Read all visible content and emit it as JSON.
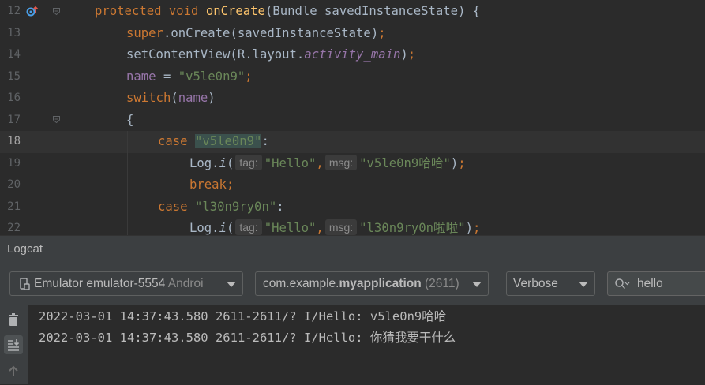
{
  "editor": {
    "lines": [
      {
        "num": "12",
        "parts": [
          {
            "t": "protected void ",
            "c": "kw"
          },
          {
            "t": "onCreate",
            "c": "fn"
          },
          {
            "t": "(Bundle savedInstanceState) {",
            "c": ""
          }
        ]
      },
      {
        "num": "13",
        "parts": [
          {
            "t": "super",
            "c": "kw"
          },
          {
            "t": ".onCreate(savedInstanceState)",
            "c": ""
          },
          {
            "t": ";",
            "c": "kw"
          }
        ]
      },
      {
        "num": "14",
        "parts": [
          {
            "t": "setContentView(R.layout.",
            "c": ""
          },
          {
            "t": "activity_main",
            "c": "ital"
          },
          {
            "t": ")",
            "c": ""
          },
          {
            "t": ";",
            "c": "kw"
          }
        ]
      },
      {
        "num": "15",
        "parts": [
          {
            "t": "name",
            "c": "fld"
          },
          {
            "t": " = ",
            "c": ""
          },
          {
            "t": "\"v5le0n9\"",
            "c": "str"
          },
          {
            "t": ";",
            "c": "kw"
          }
        ]
      },
      {
        "num": "16",
        "parts": [
          {
            "t": "switch",
            "c": "kw"
          },
          {
            "t": "(",
            "c": ""
          },
          {
            "t": "name",
            "c": "fld"
          },
          {
            "t": ")",
            "c": ""
          }
        ]
      },
      {
        "num": "17",
        "parts": [
          {
            "t": "{",
            "c": ""
          }
        ]
      },
      {
        "num": "18",
        "parts": [
          {
            "t": "case ",
            "c": "kw"
          },
          {
            "t": "\"v5le0n9\"",
            "c": "str hl"
          },
          {
            "t": ":",
            "c": ""
          }
        ]
      },
      {
        "num": "19",
        "parts": [
          {
            "t": "Log.",
            "c": ""
          },
          {
            "t": "i",
            "c": "mth"
          },
          {
            "t": "(",
            "c": ""
          },
          {
            "t": "tag:",
            "c": "hint"
          },
          {
            "t": "\"Hello\"",
            "c": "str"
          },
          {
            "t": ",",
            "c": "kw"
          },
          {
            "t": "msg:",
            "c": "hint"
          },
          {
            "t": "\"v5le0n9哈哈\"",
            "c": "str"
          },
          {
            "t": ")",
            "c": ""
          },
          {
            "t": ";",
            "c": "kw"
          }
        ]
      },
      {
        "num": "20",
        "parts": [
          {
            "t": "break;",
            "c": "kw"
          }
        ]
      },
      {
        "num": "21",
        "parts": [
          {
            "t": "case ",
            "c": "kw"
          },
          {
            "t": "\"l30n9ry0n\"",
            "c": "str"
          },
          {
            "t": ":",
            "c": ""
          }
        ]
      },
      {
        "num": "22",
        "parts": [
          {
            "t": "Log.",
            "c": ""
          },
          {
            "t": "i",
            "c": "mth"
          },
          {
            "t": "(",
            "c": ""
          },
          {
            "t": "tag:",
            "c": "hint"
          },
          {
            "t": "\"Hello\"",
            "c": "str"
          },
          {
            "t": ",",
            "c": "kw"
          },
          {
            "t": "msg:",
            "c": "hint"
          },
          {
            "t": "\"l30n9ry0n啦啦\"",
            "c": "str"
          },
          {
            "t": ")",
            "c": ""
          },
          {
            "t": ";",
            "c": "kw"
          }
        ]
      }
    ]
  },
  "logcat": {
    "title": "Logcat",
    "device": {
      "name": "Emulator emulator-5554",
      "suffix": "Androi"
    },
    "process": {
      "prefix": "com.example.",
      "app": "myapplication",
      "pid": "(2611)"
    },
    "level": "Verbose",
    "search_value": "hello",
    "entries": [
      "2022-03-01 14:37:43.580 2611-2611/? I/Hello: v5le0n9哈哈",
      "2022-03-01 14:37:43.580 2611-2611/? I/Hello: 你猜我要干什么"
    ]
  },
  "icons": {
    "override": "override-marker-icon",
    "fold": "fold-icon",
    "device": "device-icon",
    "search": "search-icon",
    "clear": "trash-icon",
    "scroll": "scroll-to-end-icon",
    "up": "arrow-up-icon"
  },
  "colors": {
    "keyword": "#cc7832",
    "function": "#ffc66d",
    "string": "#6a8759",
    "field": "#9876aa",
    "text": "#a9b7c6"
  }
}
